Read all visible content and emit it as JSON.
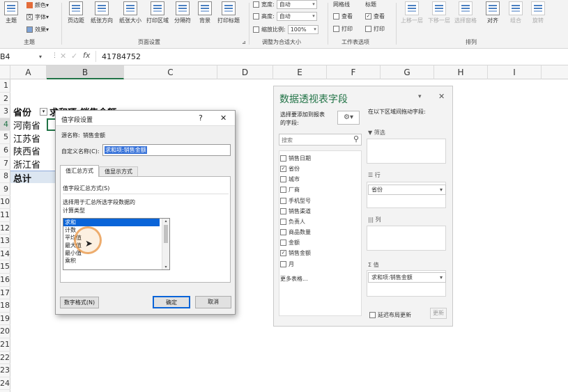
{
  "ribbon": {
    "theme": {
      "label": "主题",
      "colors": "颜色",
      "fonts": "字体",
      "effects": "效果",
      "group": "主题"
    },
    "page_setup": {
      "margins": "页边距",
      "orientation": "纸张方向",
      "size": "纸张大小",
      "print_area": "打印区域",
      "breaks": "分隔符",
      "background": "背景",
      "print_titles": "打印标题",
      "group": "页面设置"
    },
    "scale": {
      "width_label": "宽度:",
      "width_value": "自动",
      "height_label": "高度:",
      "height_value": "自动",
      "scale_label": "缩放比例:",
      "scale_value": "100%",
      "group": "调整为合适大小"
    },
    "sheet_options": {
      "gridlines": "网格线",
      "headings": "标题",
      "view": "查看",
      "print": "打印",
      "group": "工作表选项"
    },
    "arrange": {
      "bring_forward": "上移一层",
      "send_backward": "下移一层",
      "selection_pane": "选择窗格",
      "align": "对齐",
      "group_btn": "组合",
      "rotate": "旋转",
      "group": "排列"
    }
  },
  "formula_bar": {
    "name_box": "B4",
    "value": "41784752"
  },
  "columns": [
    "A",
    "B",
    "C",
    "D",
    "E",
    "F",
    "G",
    "H",
    "I"
  ],
  "rows": [
    "1",
    "2",
    "3",
    "4",
    "5",
    "6",
    "7",
    "8",
    "9",
    "10",
    "11",
    "12",
    "13",
    "14",
    "15",
    "16",
    "17",
    "18",
    "19",
    "20",
    "21",
    "22",
    "23",
    "24"
  ],
  "pivot": {
    "header_a": "省份",
    "header_b": "求和项:销售金额",
    "rows": [
      "河南省",
      "江苏省",
      "陕西省",
      "浙江省"
    ],
    "total": "总计"
  },
  "dialog": {
    "title": "值字段设置",
    "help": "?",
    "close": "✕",
    "source_label": "源名称:",
    "source_value": "销售金额",
    "custom_label": "自定义名称(C):",
    "custom_value": "求和项:销售金额",
    "tab1": "值汇总方式",
    "tab2": "值显示方式",
    "section": "值字段汇总方式(S)",
    "desc1": "选择用于汇总所选字段数据的",
    "desc2": "计算类型",
    "list": [
      "求和",
      "计数",
      "平均值",
      "最大值",
      "最小值",
      "乘积"
    ],
    "number_format": "数字格式(N)",
    "ok": "确定",
    "cancel": "取消"
  },
  "pane": {
    "title": "数据透视表字段",
    "choose_label1": "选择要添加到报表",
    "choose_label2": "的字段:",
    "search_placeholder": "搜索",
    "fields": [
      {
        "name": "销售日期",
        "checked": false
      },
      {
        "name": "省份",
        "checked": true
      },
      {
        "name": "城市",
        "checked": false
      },
      {
        "name": "厂商",
        "checked": false
      },
      {
        "name": "手机型号",
        "checked": false
      },
      {
        "name": "销售渠道",
        "checked": false
      },
      {
        "name": "负责人",
        "checked": false
      },
      {
        "name": "商品数量",
        "checked": false
      },
      {
        "name": "金额",
        "checked": false
      },
      {
        "name": "销售金额",
        "checked": true
      },
      {
        "name": "月",
        "checked": false
      }
    ],
    "more_tables": "更多表格...",
    "drag_label": "在以下区域间拖动字段:",
    "filter": "筛选",
    "rows_label": "行",
    "rows_chip": "省份",
    "cols": "列",
    "values_label": "值",
    "values_chip": "求和项:销售金额",
    "defer": "延迟布局更新",
    "update": "更新"
  }
}
